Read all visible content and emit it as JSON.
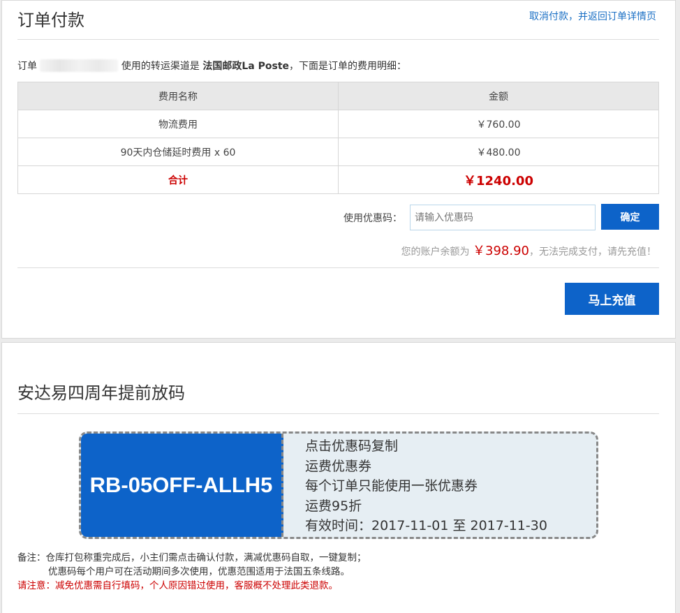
{
  "payment": {
    "title": "订单付款",
    "cancel_link": "取消付款，并返回订单详情页",
    "order_prefix": "订单",
    "order_middle": "使用的转运渠道是",
    "channel": "法国邮政La Poste",
    "order_suffix": "，下面是订单的费用明细：",
    "table": {
      "headers": [
        "费用名称",
        "金额"
      ],
      "rows": [
        {
          "name": "物流费用",
          "amount": "￥760.00"
        },
        {
          "name": "90天内仓储延时费用 x 60",
          "amount": "￥480.00"
        }
      ],
      "total_label": "合计",
      "total_value": "￥1240.00"
    },
    "coupon": {
      "label": "使用优惠码：",
      "placeholder": "请输入优惠码",
      "confirm_button": "确定"
    },
    "balance": {
      "prefix": "您的账户余额为",
      "amount": "￥398.90",
      "suffix": "，无法完成支付，请先充值！"
    },
    "recharge_button": "马上充值"
  },
  "promo": {
    "title": "安达易四周年提前放码",
    "coupon_code": "RB-05OFF-ALLH5",
    "details": [
      "点击优惠码复制",
      "运费优惠券",
      "每个订单只能使用一张优惠券",
      "运费95折",
      "有效时间：2017-11-01 至 2017-11-30"
    ],
    "notes": {
      "line1": "备注：仓库打包称重完成后，小主们需点击确认付款，满减优惠码自取，一键复制；",
      "line2": "优惠码每个用户可在活动期间多次使用，优惠范围适用于法国五条线路。",
      "warning": "请注意：减免优惠需自行填码，个人原因错过使用，客服概不处理此类退款。"
    }
  },
  "colors": {
    "accent_blue": "#0d63c9",
    "link_blue": "#1a6fc4",
    "alert_red": "#cc0000"
  }
}
